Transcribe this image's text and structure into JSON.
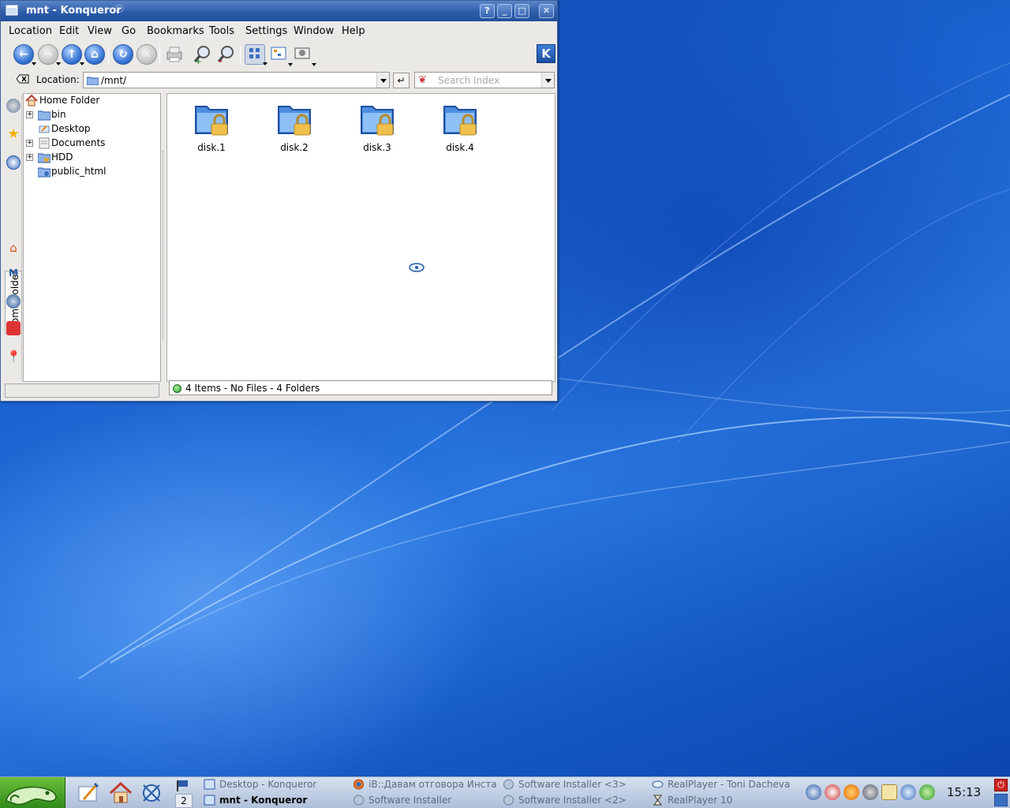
{
  "window": {
    "title": "mnt - Konqueror",
    "accent": "#2a5aa8",
    "buttons": {
      "help": "?",
      "minimize": "_",
      "maximize": "□",
      "close": "✕"
    }
  },
  "menu": [
    {
      "label": "Location"
    },
    {
      "label": "Edit"
    },
    {
      "label": "View"
    },
    {
      "label": "Go"
    },
    {
      "label": "Bookmarks"
    },
    {
      "label": "Tools"
    },
    {
      "label": "Settings"
    },
    {
      "label": "Window"
    },
    {
      "label": "Help"
    }
  ],
  "toolbar": {
    "icons": [
      "back-icon",
      "forward-icon",
      "up-icon",
      "home-icon",
      "reload-icon",
      "stop-icon",
      "print-icon",
      "zoom-in-icon",
      "zoom-out-icon",
      "icon-view-icon",
      "tree-view-icon",
      "image-view-icon"
    ],
    "kde_logo": "K"
  },
  "location": {
    "label": "Location:",
    "value": "/mnt/",
    "go_label": "↵",
    "search_placeholder": "Search Index"
  },
  "sidebar": {
    "tab_label": "Home Folder",
    "tree": [
      {
        "label": "Home Folder",
        "icon": "home-icon",
        "expandable": false
      },
      {
        "label": "bin",
        "icon": "folder-icon",
        "expandable": true,
        "expander": "+"
      },
      {
        "label": "Desktop",
        "icon": "desktop-icon",
        "expandable": false
      },
      {
        "label": "Documents",
        "icon": "documents-icon",
        "expandable": true,
        "expander": "+"
      },
      {
        "label": "HDD",
        "icon": "folder-icon",
        "expandable": true,
        "expander": "+"
      },
      {
        "label": "public_html",
        "icon": "web-folder-icon",
        "expandable": false
      }
    ]
  },
  "files": [
    {
      "name": "disk.1",
      "icon": "locked-folder-icon"
    },
    {
      "name": "disk.2",
      "icon": "locked-folder-icon"
    },
    {
      "name": "disk.3",
      "icon": "locked-folder-icon"
    },
    {
      "name": "disk.4",
      "icon": "locked-folder-icon"
    }
  ],
  "status": {
    "text": "4 Items - No Files - 4 Folders"
  },
  "taskbar": {
    "pager_number": "2",
    "tasks": [
      {
        "label": "Desktop - Konqueror",
        "icon": "konqueror-icon",
        "active": false
      },
      {
        "label": "mnt - Konqueror",
        "icon": "konqueror-icon",
        "active": true
      },
      {
        "label": "iB::Давам отговора Инстал",
        "icon": "firefox-icon",
        "active": false
      },
      {
        "label": "Software Installer",
        "icon": "installer-icon",
        "active": false
      },
      {
        "label": "Software Installer <3>",
        "icon": "installer-icon",
        "active": false
      },
      {
        "label": "Software Installer <2>",
        "icon": "installer-icon",
        "active": false
      },
      {
        "label": "RealPlayer - Toni Dacheva",
        "icon": "realplayer-icon",
        "active": false
      },
      {
        "label": "RealPlayer 10",
        "icon": "hourglass-icon",
        "active": false
      }
    ],
    "tray_icons": [
      "volume-icon",
      "clipboard-icon",
      "update-alert-icon",
      "network-icon",
      "kwallet-icon",
      "globe-icon",
      "check-icon"
    ],
    "clock": "15:13"
  }
}
